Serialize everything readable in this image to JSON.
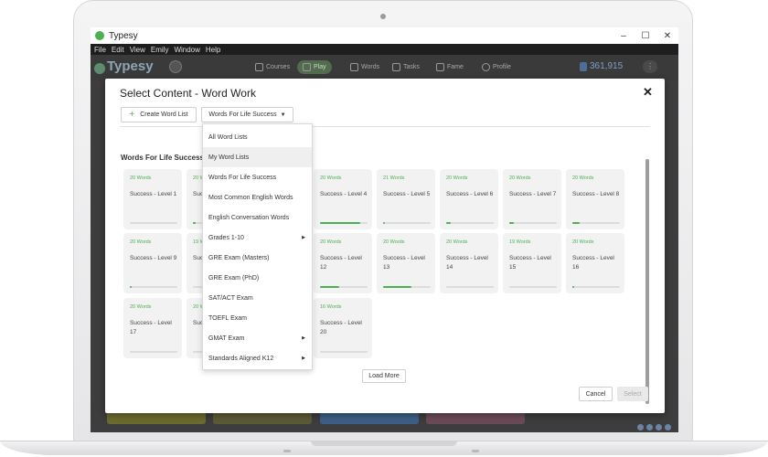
{
  "window": {
    "title": "Typesy",
    "menu": [
      "File",
      "Edit",
      "View",
      "Emily",
      "Window",
      "Help"
    ],
    "controls": [
      "–",
      "☐",
      "✕"
    ]
  },
  "app": {
    "logo": "Typesy",
    "nav": [
      {
        "label": "Courses",
        "icon": "bulb-icon"
      },
      {
        "label": "Play",
        "icon": "gamepad-icon"
      },
      {
        "label": "Words",
        "icon": "book-icon"
      },
      {
        "label": "Tasks",
        "icon": "clipboard-icon"
      },
      {
        "label": "Fame",
        "icon": "star-icon"
      },
      {
        "label": "Profile",
        "icon": "avatar-icon"
      }
    ],
    "score": "361,915",
    "more": "⋮"
  },
  "modal": {
    "title": "Select Content - Word Work",
    "close": "✕",
    "create_label": "Create Word List",
    "filter_label": "Words For Life Success",
    "section_title": "Words For Life Success",
    "load_more": "Load More",
    "cancel": "Cancel",
    "select": "Select"
  },
  "dropdown": {
    "items": [
      {
        "label": "All Word Lists",
        "submenu": false
      },
      {
        "label": "My Word Lists",
        "submenu": false
      },
      {
        "label": "Words For Life Success",
        "submenu": false
      },
      {
        "label": "Most Common English Words",
        "submenu": false
      },
      {
        "label": "English Conversation Words",
        "submenu": false
      },
      {
        "label": "Grades 1-10",
        "submenu": true
      },
      {
        "label": "GRE Exam (Masters)",
        "submenu": false
      },
      {
        "label": "GRE Exam (PhD)",
        "submenu": false
      },
      {
        "label": "SAT/ACT Exam",
        "submenu": false
      },
      {
        "label": "TOEFL Exam",
        "submenu": false
      },
      {
        "label": "GMAT Exam",
        "submenu": true
      },
      {
        "label": "Standards Aligned K12",
        "submenu": true
      }
    ],
    "hovered_index": 1
  },
  "cards": [
    {
      "count": "20 Words",
      "name": "Success - Level 1",
      "progress": 0
    },
    {
      "count": "20 W",
      "name": "Suc 2",
      "progress": 0.05
    },
    {
      "count": "20 Words",
      "name": "Success - Level 4",
      "progress": 0.85
    },
    {
      "count": "21 Words",
      "name": "Success - Level 5",
      "progress": 0.04
    },
    {
      "count": "20 Words",
      "name": "Success - Level 6",
      "progress": 0.1
    },
    {
      "count": "20 Words",
      "name": "Success - Level 7",
      "progress": 0.1
    },
    {
      "count": "20 Words",
      "name": "Success - Level 8",
      "progress": 0.15
    },
    {
      "count": "20 Words",
      "name": "Success - Level 9",
      "progress": 0.04
    },
    {
      "count": "19 W",
      "name": "Suc 10",
      "progress": 0
    },
    {
      "count": "20 Words",
      "name": "Success - Level 12",
      "progress": 0.4
    },
    {
      "count": "20 Words",
      "name": "Success - Level 13",
      "progress": 0.6
    },
    {
      "count": "20 Words",
      "name": "Success - Level 14",
      "progress": 0
    },
    {
      "count": "19 Words",
      "name": "Success - Level 15",
      "progress": 0
    },
    {
      "count": "20 Words",
      "name": "Success - Level 16",
      "progress": 0.03
    },
    {
      "count": "20 Words",
      "name": "Success - Level 17",
      "progress": 0
    },
    {
      "count": "20 W",
      "name": "Suc 18",
      "progress": 0
    },
    {
      "count": "16 Words",
      "name": "Success - Level 20",
      "progress": 0
    }
  ],
  "colors": {
    "accent": "#4caf50",
    "overlay": "#3d3d3d"
  }
}
